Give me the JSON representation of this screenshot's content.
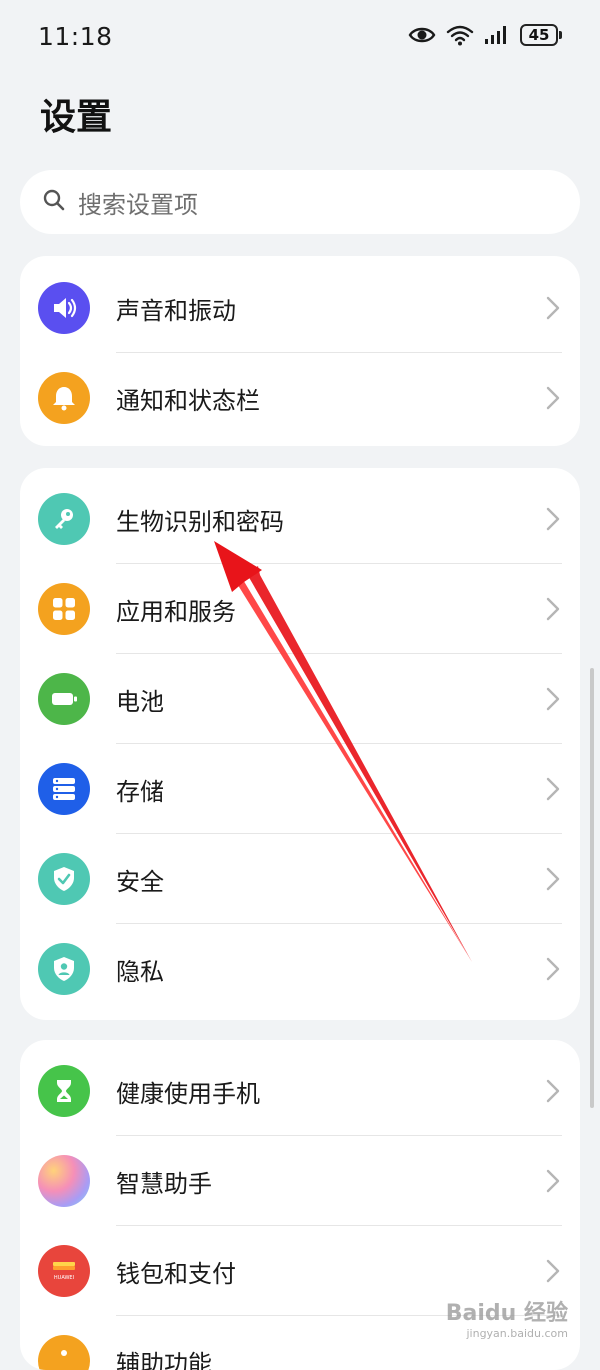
{
  "status_bar": {
    "time": "11:18",
    "battery_level": "45",
    "icons": [
      "eye-icon",
      "wifi-icon",
      "signal-icon",
      "battery-icon"
    ]
  },
  "page": {
    "title": "设置"
  },
  "search": {
    "placeholder": "搜索设置项"
  },
  "groups": [
    {
      "items": [
        {
          "label": "声音和振动",
          "icon": "speaker-icon",
          "color": "#5a4ff0"
        },
        {
          "label": "通知和状态栏",
          "icon": "bell-icon",
          "color": "#f4a21f"
        }
      ]
    },
    {
      "items": [
        {
          "label": "生物识别和密码",
          "icon": "key-icon",
          "color": "#4fc8b3"
        },
        {
          "label": "应用和服务",
          "icon": "apps-icon",
          "color": "#f4a21f"
        },
        {
          "label": "电池",
          "icon": "battery-setting-icon",
          "color": "#4db649"
        },
        {
          "label": "存储",
          "icon": "storage-icon",
          "color": "#1f5fe8"
        },
        {
          "label": "安全",
          "icon": "shield-check-icon",
          "color": "#4fc8b3"
        },
        {
          "label": "隐私",
          "icon": "privacy-icon",
          "color": "#4fc8b3"
        }
      ]
    },
    {
      "items": [
        {
          "label": "健康使用手机",
          "icon": "hourglass-icon",
          "color": "#46c44a"
        },
        {
          "label": "智慧助手",
          "icon": "assistant-icon",
          "color": "#e88bd0"
        },
        {
          "label": "钱包和支付",
          "icon": "wallet-icon",
          "color": "#e8453c"
        },
        {
          "label": "辅助功能",
          "icon": "accessibility-icon",
          "color": "#f4a21f"
        }
      ]
    }
  ],
  "annotation": {
    "arrow_color": "#e8141a"
  },
  "watermark": {
    "brand": "Baidu 经验",
    "url": "jingyan.baidu.com"
  }
}
